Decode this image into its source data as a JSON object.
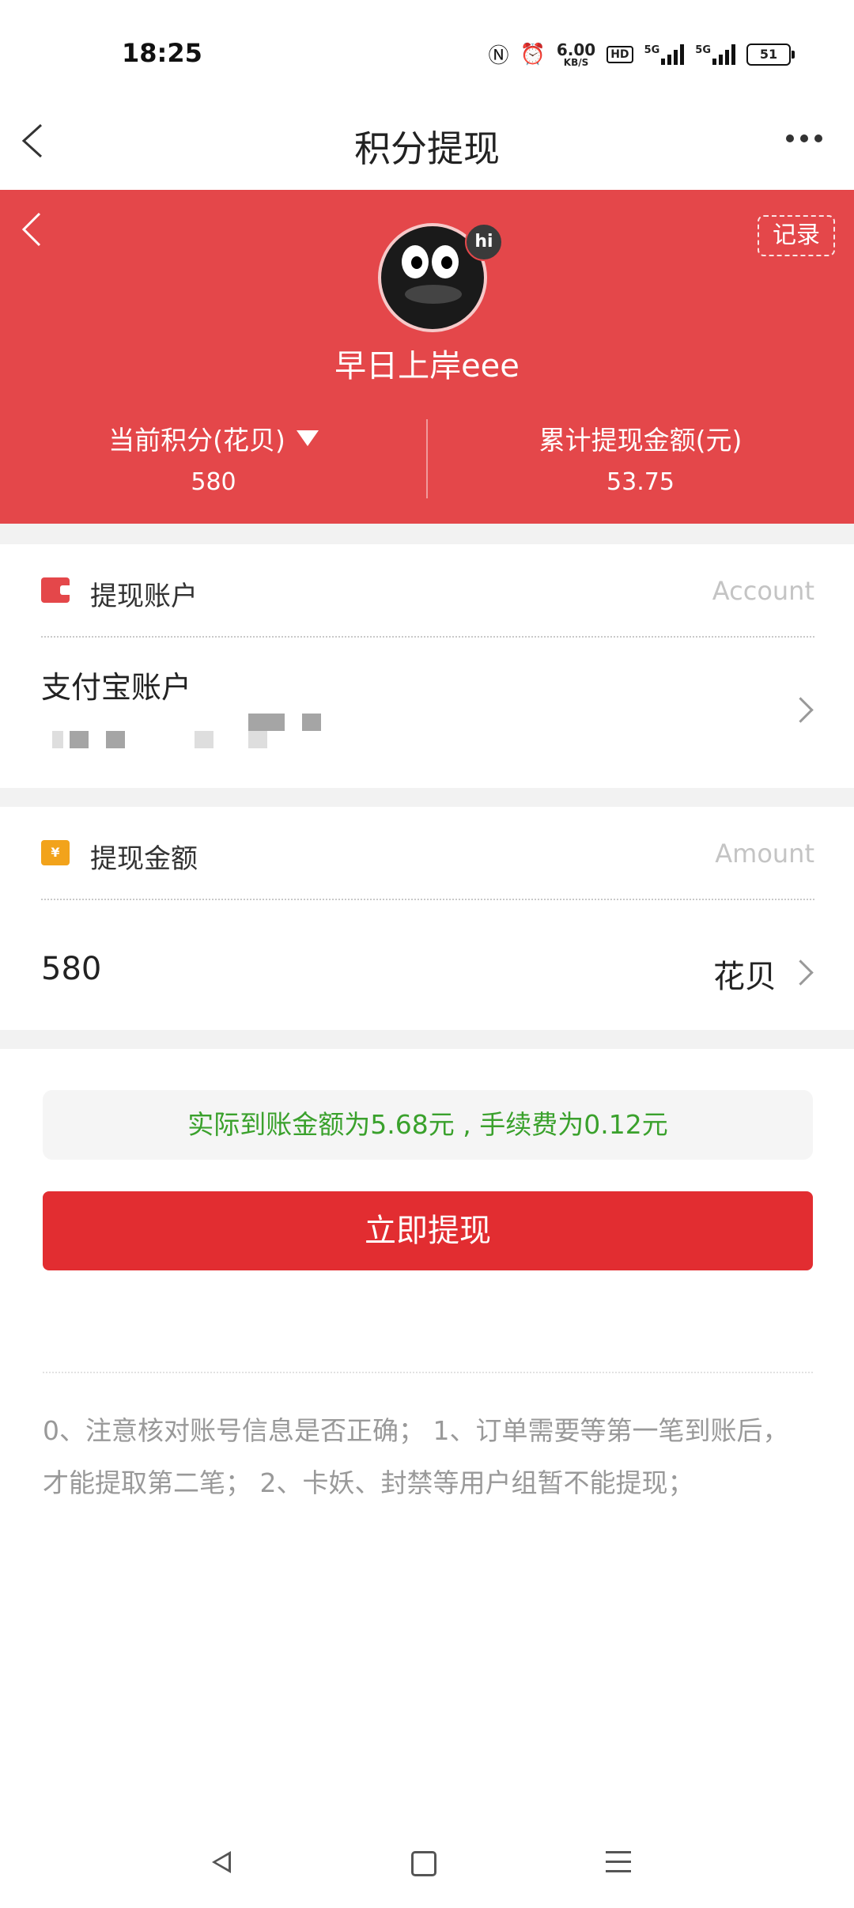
{
  "status_bar": {
    "time": "18:25",
    "net_speed_value": "6.00",
    "net_speed_unit": "KB/S",
    "hd_label": "HD",
    "sig1_label": "5G",
    "sig2_label": "5G",
    "battery": "51"
  },
  "header": {
    "title": "积分提现"
  },
  "profile": {
    "records_label": "记录",
    "hi_badge": "hi",
    "username": "早日上岸eee",
    "points_label": "当前积分(花贝)",
    "points_value": "580",
    "total_label": "累计提现金额(元)",
    "total_value": "53.75"
  },
  "account_card": {
    "title": "提现账户",
    "en_label": "Account",
    "account_name": "支付宝账户"
  },
  "amount_card": {
    "title": "提现金额",
    "en_label": "Amount",
    "icon_glyph": "¥",
    "amount": "580",
    "unit": "花贝"
  },
  "notice": "实际到账金额为5.68元 , 手续费为0.12元",
  "withdraw_button": "立即提现",
  "note": "0、注意核对账号信息是否正确； 1、订单需要等第一笔到账后，才能提取第二笔； 2、卡妖、封禁等用户组暂不能提现；",
  "colors": {
    "brand_red": "#e4474a",
    "button_red": "#e22d31",
    "notice_green": "#3aa12c",
    "coin_orange": "#f2a31b"
  },
  "icons": [
    "back-icon",
    "more-icon",
    "wallet-icon",
    "money-icon",
    "chevron-right-icon",
    "dropdown-triangle-icon"
  ]
}
